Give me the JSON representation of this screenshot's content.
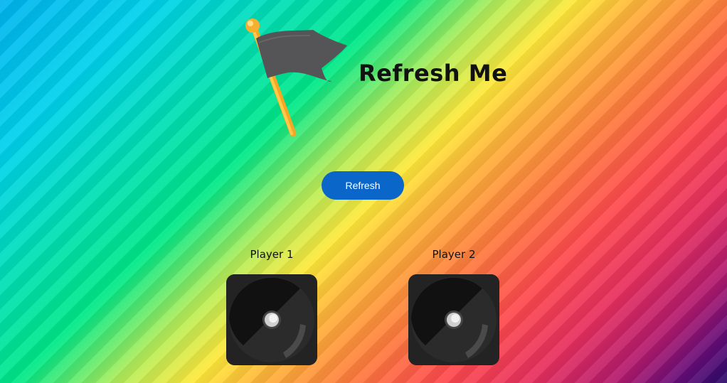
{
  "header": {
    "title": "Refresh Me",
    "logo_icon": "flag-icon"
  },
  "controls": {
    "refresh_label": "Refresh"
  },
  "players": [
    {
      "label": "Player 1",
      "die_icon": "die-icon"
    },
    {
      "label": "Player 2",
      "die_icon": "die-icon"
    }
  ],
  "colors": {
    "button": "#0a66c8",
    "die_background": "#222222",
    "flag": "#555555",
    "pole": "#ffc23a"
  }
}
